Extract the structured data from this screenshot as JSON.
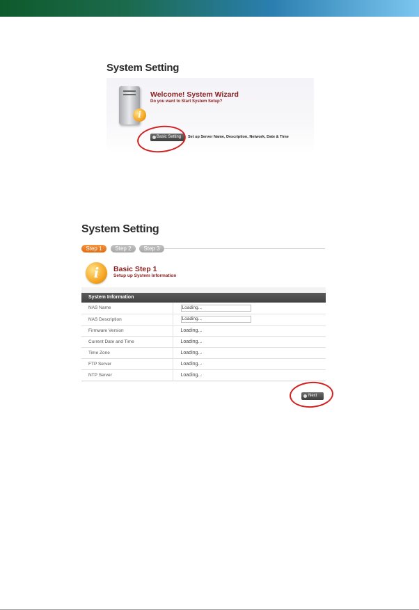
{
  "colors": {
    "accent_dark_red": "#8a1e1e",
    "step_active": "#e26a10",
    "step_inactive": "#a6a6a6",
    "highlight_circle": "#d42020",
    "table_header": "#4a4a4a"
  },
  "wizard": {
    "title": "System Setting",
    "welcome_title": "Welcome!  System Wizard",
    "welcome_subtitle": "Do you want to Start System Setup?",
    "basic_setting_button": "Basic Setting",
    "basic_setting_description": "Set up Server Name, Description, Network, Date & Time",
    "icons": {
      "device": "nas-device-icon",
      "info": "info-icon"
    }
  },
  "setup": {
    "title": "System Setting",
    "steps": [
      {
        "label": "Step 1",
        "active": true
      },
      {
        "label": "Step 2",
        "active": false
      },
      {
        "label": "Step 3",
        "active": false
      }
    ],
    "step_title": "Basic Step 1",
    "step_subtitle": "Setup up System Information",
    "section_title": "System Information",
    "rows": [
      {
        "label": "NAS Name",
        "value": "Loading...",
        "input": true
      },
      {
        "label": "NAS Description",
        "value": "Loading...",
        "input": true
      },
      {
        "label": "Firmware Version",
        "value": "Loading...",
        "input": false
      },
      {
        "label": "Current Date and Time",
        "value": "Loading...",
        "input": false
      },
      {
        "label": "Time Zone",
        "value": "Loading...",
        "input": false
      },
      {
        "label": "FTP Server",
        "value": "Loading...",
        "input": false
      },
      {
        "label": "NTP Server",
        "value": "Loading...",
        "input": false
      }
    ],
    "next_button": "Next"
  }
}
